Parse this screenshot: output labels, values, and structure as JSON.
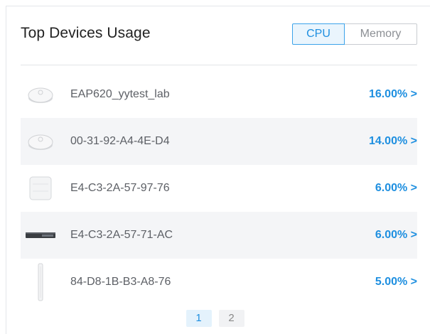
{
  "widget": {
    "title": "Top Devices Usage",
    "toggle": {
      "cpu_label": "CPU",
      "memory_label": "Memory",
      "selected": "CPU"
    }
  },
  "devices": [
    {
      "name": "EAP620_yytest_lab",
      "usage": "16.00% >",
      "icon": "ceiling-ap-icon"
    },
    {
      "name": "00-31-92-A4-4E-D4",
      "usage": "14.00% >",
      "icon": "ceiling-ap-icon"
    },
    {
      "name": "E4-C3-2A-57-97-76",
      "usage": "6.00% >",
      "icon": "square-ap-icon"
    },
    {
      "name": "E4-C3-2A-57-71-AC",
      "usage": "6.00% >",
      "icon": "switch-icon"
    },
    {
      "name": "84-D8-1B-B3-A8-76",
      "usage": "5.00% >",
      "icon": "outdoor-ap-icon"
    }
  ],
  "pagination": {
    "pages": [
      "1",
      "2"
    ],
    "current": "1"
  },
  "colors": {
    "accent": "#1e8fe0",
    "row_alt": "#f4f5f7"
  }
}
